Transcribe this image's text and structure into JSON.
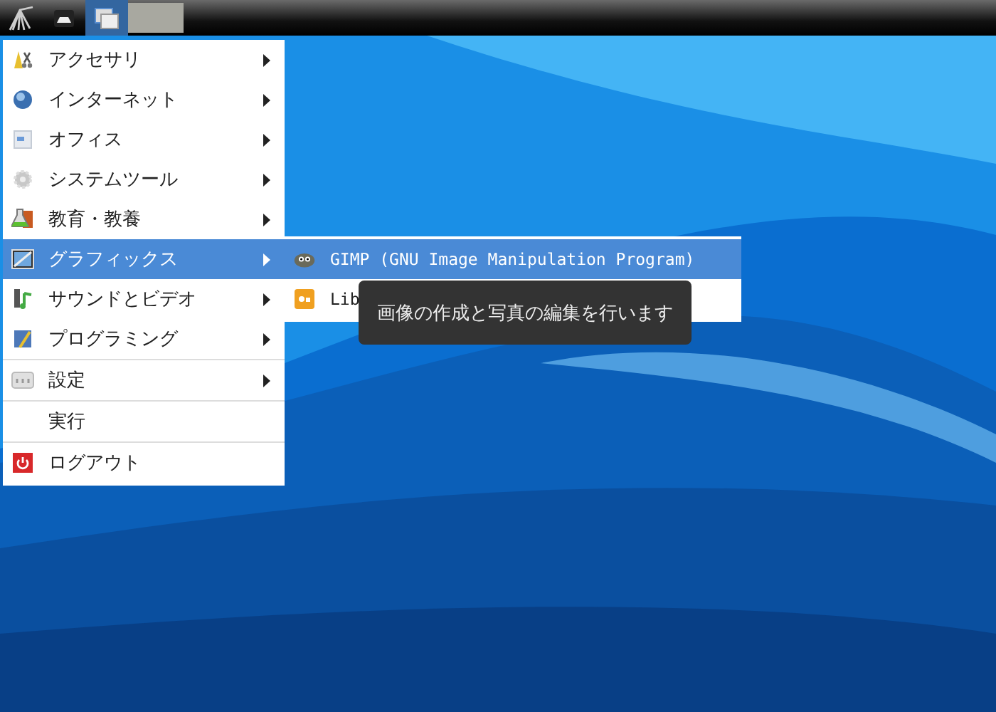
{
  "taskbar": {
    "buttons": [
      {
        "selected": false
      },
      {
        "selected": false
      },
      {
        "selected": true
      },
      {
        "selected": false
      }
    ]
  },
  "menu": {
    "items": [
      {
        "label": "アクセサリ",
        "submenu": true,
        "selected": false
      },
      {
        "label": "インターネット",
        "submenu": true,
        "selected": false
      },
      {
        "label": "オフィス",
        "submenu": true,
        "selected": false
      },
      {
        "label": "システムツール",
        "submenu": true,
        "selected": false
      },
      {
        "label": "教育・教養",
        "submenu": true,
        "selected": false
      },
      {
        "label": "グラフィックス",
        "submenu": true,
        "selected": true
      },
      {
        "label": "サウンドとビデオ",
        "submenu": true,
        "selected": false
      },
      {
        "label": "プログラミング",
        "submenu": true,
        "selected": false,
        "separator_after": true
      },
      {
        "label": "設定",
        "submenu": true,
        "selected": false,
        "separator_after": true
      },
      {
        "label": "実行",
        "submenu": false,
        "selected": false,
        "separator_after": true
      },
      {
        "label": "ログアウト",
        "submenu": false,
        "selected": false
      }
    ]
  },
  "submenu": {
    "items": [
      {
        "label": "GIMP (GNU Image Manipulation Program)",
        "selected": true
      },
      {
        "label": "Lib",
        "selected": false
      }
    ]
  },
  "tooltip": {
    "text": "画像の作成と写真の編集を行います"
  }
}
